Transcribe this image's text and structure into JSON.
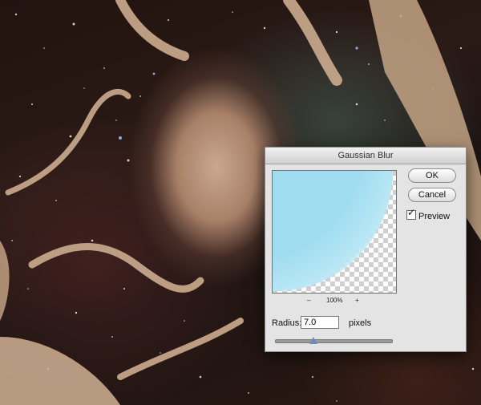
{
  "dialog": {
    "title": "Gaussian Blur",
    "ok_label": "OK",
    "cancel_label": "Cancel",
    "preview_label": "Preview",
    "preview_checked": true,
    "zoom_out_label": "–",
    "zoom_level": "100%",
    "zoom_in_label": "+",
    "radius_label": "Radius:",
    "radius_value": "7.0",
    "radius_unit": "pixels",
    "radius_slider_fraction": 0.33
  },
  "colors": {
    "dialog_bg": "#e4e4e4",
    "preview_tint": "#9fdcf0",
    "slider_thumb": "#6c8fb8"
  }
}
